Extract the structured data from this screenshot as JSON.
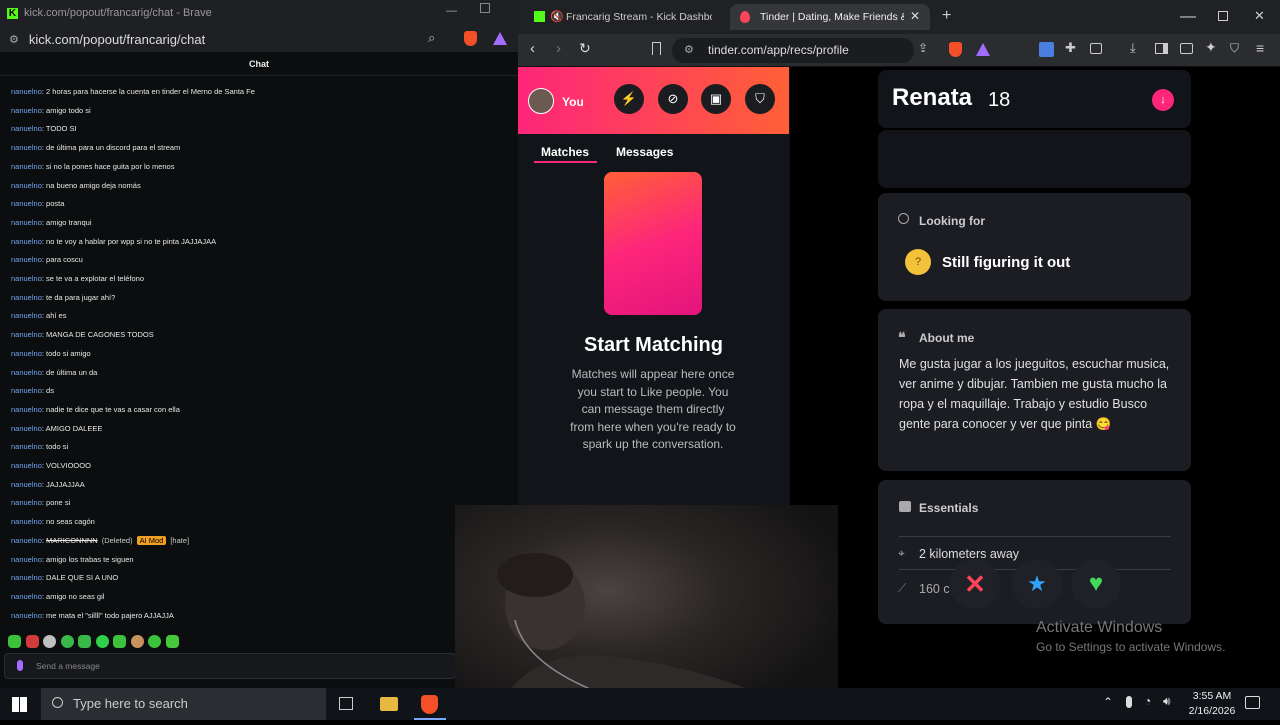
{
  "left_window": {
    "title": "kick.com/popout/francarig/chat - Brave",
    "url": "kick.com/popout/francarig/chat",
    "chat_header": "Chat",
    "messages": [
      {
        "user": "nanuelno",
        "text": "2 horas para hacerse la cuenta en tinder el Merno de Santa Fe"
      },
      {
        "user": "nanuelno",
        "text": "amigo todo si"
      },
      {
        "user": "nanuelno",
        "text": "TODO SI"
      },
      {
        "user": "nanuelno",
        "text": "de última para un discord para el stream"
      },
      {
        "user": "nanuelno",
        "text": "si no la pones hace guita por lo menos"
      },
      {
        "user": "nanuelno",
        "text": "na bueno amigo deja nomás"
      },
      {
        "user": "nanuelno",
        "text": "posta"
      },
      {
        "user": "nanuelno",
        "text": "amigo tranqui"
      },
      {
        "user": "nanuelno",
        "text": "no te voy a hablar por wpp si no te pinta JAJJAJAA"
      },
      {
        "user": "nanuelno",
        "text": "para coscu"
      },
      {
        "user": "nanuelno",
        "text": "se te va a explotar el teléfono"
      },
      {
        "user": "nanuelno",
        "text": "te da para jugar ahí?"
      },
      {
        "user": "nanuelno",
        "text": "ahí es"
      },
      {
        "user": "nanuelno",
        "text": "MANGA DE CAGONES TODOS"
      },
      {
        "user": "nanuelno",
        "text": "todo si amigo"
      },
      {
        "user": "nanuelno",
        "text": "de última un da"
      },
      {
        "user": "nanuelno",
        "text": "ds"
      },
      {
        "user": "nanuelno",
        "text": "nadie te dice que te vas a casar con ella"
      },
      {
        "user": "nanuelno",
        "text": "AMIGO DALEEE"
      },
      {
        "user": "nanuelno",
        "text": "todo si"
      },
      {
        "user": "nanuelno",
        "text": "VOLVIOOOO"
      },
      {
        "user": "nanuelno",
        "text": "JAJJAJJAA"
      },
      {
        "user": "nanuelno",
        "text": "pone si"
      },
      {
        "user": "nanuelno",
        "text": "no seas cagón"
      },
      {
        "user": "nanuelno",
        "text": "MARICONNNN"
      },
      {
        "user": "nanuelno",
        "text": "amigo los trabas te siguen"
      },
      {
        "user": "nanuelno",
        "text": "DALE QUE SI A UNO"
      },
      {
        "user": "nanuelno",
        "text": "amigo no seas gil"
      },
      {
        "user": "nanuelno",
        "text": "me mata el \"sillll\" todo pajero AJJAJJA"
      }
    ],
    "deleted_label": "(Deleted)",
    "ai_mod_label": "AI Mod",
    "hate_label": "[hate]",
    "send_placeholder": "Send a message"
  },
  "right_window": {
    "tabs": [
      {
        "label": "Francarig Stream - Kick Dashboard"
      },
      {
        "label": "Tinder | Dating, Make Friends & M"
      }
    ],
    "url": "tinder.com/app/recs/profile",
    "you_label": "You",
    "nav_tabs": {
      "matches": "Matches",
      "messages": "Messages"
    },
    "start_title": "Start Matching",
    "start_body": "Matches will appear here once you start to Like people. You can message them directly from here when you're ready to spark up the conversation.",
    "profile": {
      "name": "Renata",
      "age": "18",
      "looking_for_label": "Looking for",
      "looking_for_value": "Still figuring it out",
      "about_label": "About me",
      "about_text": "Me gusta jugar a los jueguitos, escuchar musica, ver anime y dibujar. Tambien me gusta mucho la ropa y el maquillaje. Trabajo y estudio Busco gente para conocer y ver que pinta 😋",
      "essentials_label": "Essentials",
      "distance": "2 kilometers away",
      "height_partial": "160 c"
    },
    "watermark": {
      "title": "Activate Windows",
      "subtitle": "Go to Settings to activate Windows."
    }
  },
  "taskbar": {
    "search_placeholder": "Type here to search",
    "time": "3:55 AM",
    "date": "2/16/2026"
  },
  "colors": {
    "tinder_pink": "#fd267a",
    "tinder_orange": "#ff6036",
    "kick_green": "#53fc18",
    "chat_user": "#6fa8f5"
  }
}
